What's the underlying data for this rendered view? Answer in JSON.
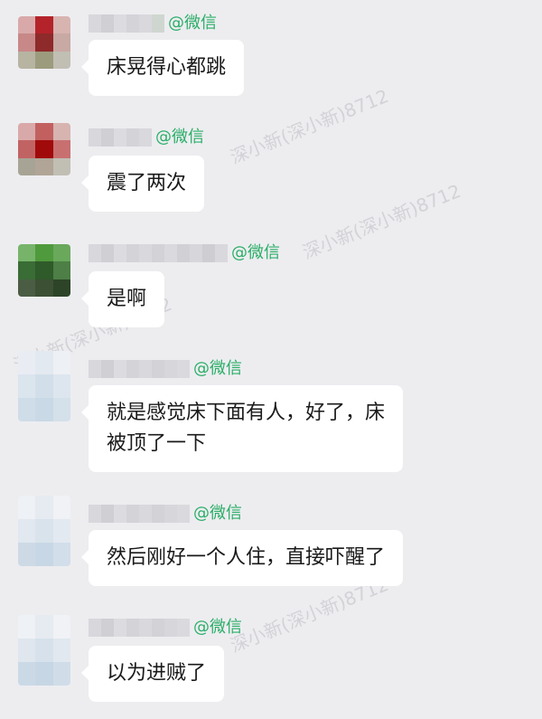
{
  "watermark": "深小新(深小新)8712",
  "suffix": "@微信",
  "messages": [
    {
      "text": "床晃得心都跳"
    },
    {
      "text": "震了两次"
    },
    {
      "text": "是啊"
    },
    {
      "text_line1": "就是感觉床下面有人，好了，床",
      "text_line2": "被顶了一下"
    },
    {
      "text": "然后刚好一个人住，直接吓醒了"
    },
    {
      "text": "以为进贼了"
    }
  ],
  "colors": {
    "background": "#ededf0",
    "bubble": "#ffffff",
    "suffix": "#2aae67"
  },
  "avatar_icons": [
    "user-avatar-red",
    "user-avatar-red",
    "user-avatar-green",
    "user-avatar-blue",
    "user-avatar-blue",
    "user-avatar-blue"
  ]
}
